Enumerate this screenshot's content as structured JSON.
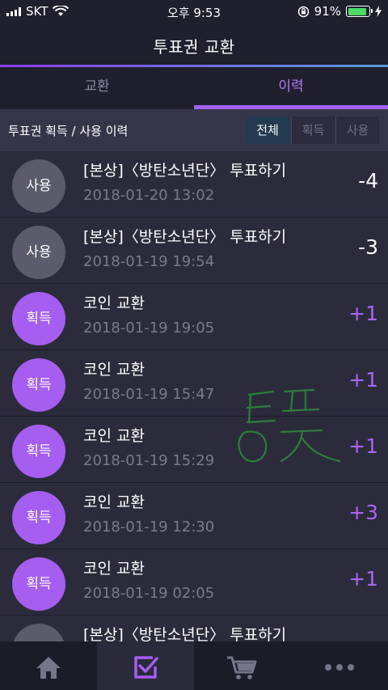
{
  "status_bar": {
    "carrier": "SKT",
    "time": "오후 9:53",
    "battery": "91%",
    "battery_level": 0.91
  },
  "header": {
    "title": "투표권 교환"
  },
  "tabs": [
    {
      "label": "교환",
      "active": false
    },
    {
      "label": "이력",
      "active": true
    }
  ],
  "filter": {
    "title": "투표권 획득 / 사용 이력",
    "options": [
      "전체",
      "획득",
      "사용"
    ],
    "selected": "전체"
  },
  "history": [
    {
      "badge": "사용",
      "type": "used",
      "title": "[본상]〈방탄소년단〉 투표하기",
      "date": "2018-01-20 13:02",
      "amount": "-4"
    },
    {
      "badge": "사용",
      "type": "used",
      "title": "[본상]〈방탄소년단〉 투표하기",
      "date": "2018-01-19 19:54",
      "amount": "-3"
    },
    {
      "badge": "획득",
      "type": "got",
      "title": "코인 교환",
      "date": "2018-01-19 19:05",
      "amount": "+1"
    },
    {
      "badge": "획득",
      "type": "got",
      "title": "코인 교환",
      "date": "2018-01-19 15:47",
      "amount": "+1"
    },
    {
      "badge": "획득",
      "type": "got",
      "title": "코인 교환",
      "date": "2018-01-19 15:29",
      "amount": "+1"
    },
    {
      "badge": "획득",
      "type": "got",
      "title": "코인 교환",
      "date": "2018-01-19 12:30",
      "amount": "+3"
    },
    {
      "badge": "획득",
      "type": "got",
      "title": "코인 교환",
      "date": "2018-01-19 02:05",
      "amount": "+1"
    },
    {
      "badge": "사용",
      "type": "used",
      "title": "[본상]〈방탄소년단〉 투표하기",
      "date": "",
      "amount": "-"
    }
  ],
  "bottom_nav": [
    {
      "icon": "home-icon",
      "active": false
    },
    {
      "icon": "vote-check-icon",
      "active": true
    },
    {
      "icon": "cart-icon",
      "active": false
    },
    {
      "icon": "more-icon",
      "active": false
    }
  ],
  "colors": {
    "accent": "#a55ef0",
    "background": "#2b2b3c",
    "header": "#1f1f2e"
  }
}
